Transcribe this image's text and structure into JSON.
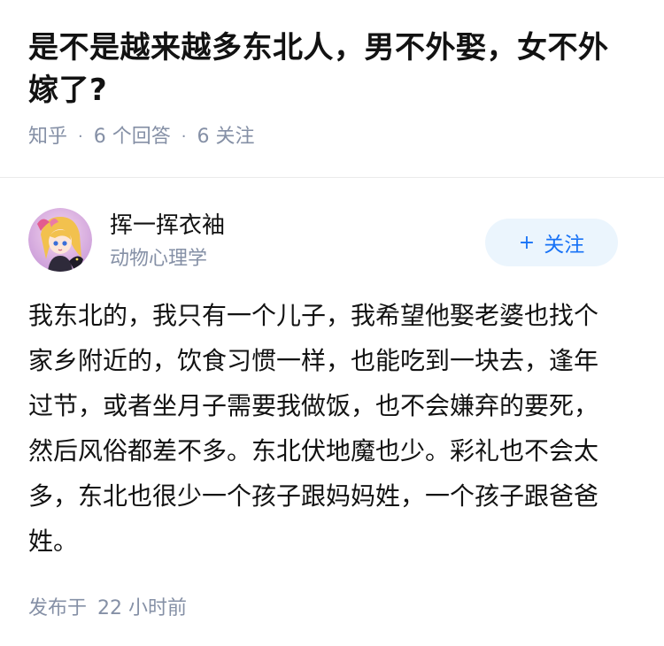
{
  "question": {
    "title": "是不是越来越多东北人，男不外娶，女不外嫁了?",
    "source": "知乎",
    "answers_count": "6 个回答",
    "followers_count": "6 关注"
  },
  "answer": {
    "author": {
      "name": "挥一挥衣袖",
      "bio": "动物心理学",
      "avatar_icon": "avatar-anime-girl"
    },
    "follow_button": {
      "plus": "+",
      "label": "关注"
    },
    "content": "我东北的，我只有一个儿子，我希望他娶老婆也找个家乡附近的，饮食习惯一样，也能吃到一块去，逢年过节，或者坐月子需要我做饭，也不会嫌弃的要死，然后风俗都差不多。东北伏地魔也少。彩礼也不会太多，东北也很少一个孩子跟妈妈姓，一个孩子跟爸爸姓。",
    "published_label": "发布于",
    "published_time": "22 小时前"
  },
  "colors": {
    "accent": "#1772f6",
    "accent_bg": "#ebf5fd",
    "meta_text": "#8590a6",
    "body_text": "#121212"
  }
}
